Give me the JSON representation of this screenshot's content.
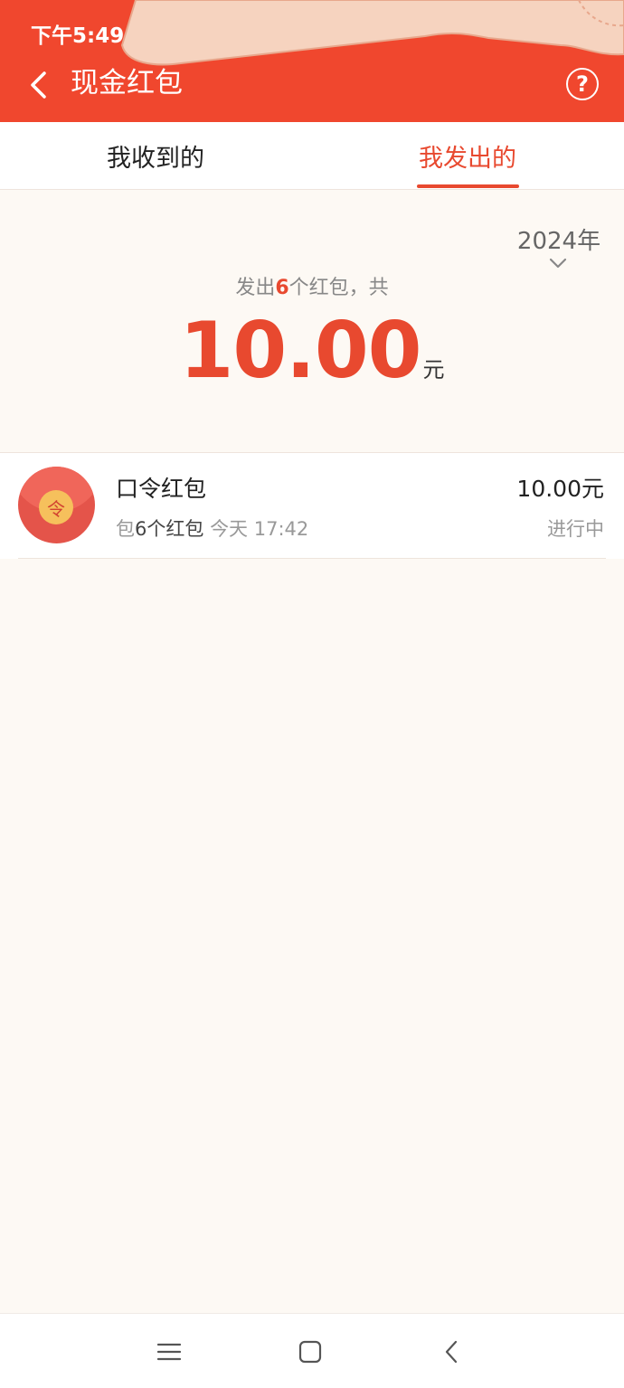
{
  "status_bar": {
    "time": "下午5:49"
  },
  "header": {
    "title": "现金红包",
    "back_icon": "chevron-left-icon",
    "help_icon": "question-circle-icon",
    "background_color": "#f0472e"
  },
  "tabs": [
    {
      "label": "我收到的",
      "active": false
    },
    {
      "label": "我发出的",
      "active": true
    }
  ],
  "summary": {
    "year": "2024年",
    "prefix": "发出",
    "count": "6",
    "suffix": "个红包，共",
    "amount": "10.00",
    "unit": "元"
  },
  "items": [
    {
      "icon_char": "令",
      "title": "口令红包",
      "sub_prefix": "包",
      "sub_count": "6个红包",
      "time": "今天 17:42",
      "amount": "10.00元",
      "status": "进行中"
    }
  ],
  "accent_color": "#e8492f",
  "navbar": {
    "menu_icon": "menu-icon",
    "home_icon": "home-square-icon",
    "back_icon": "back-triangle-icon"
  }
}
